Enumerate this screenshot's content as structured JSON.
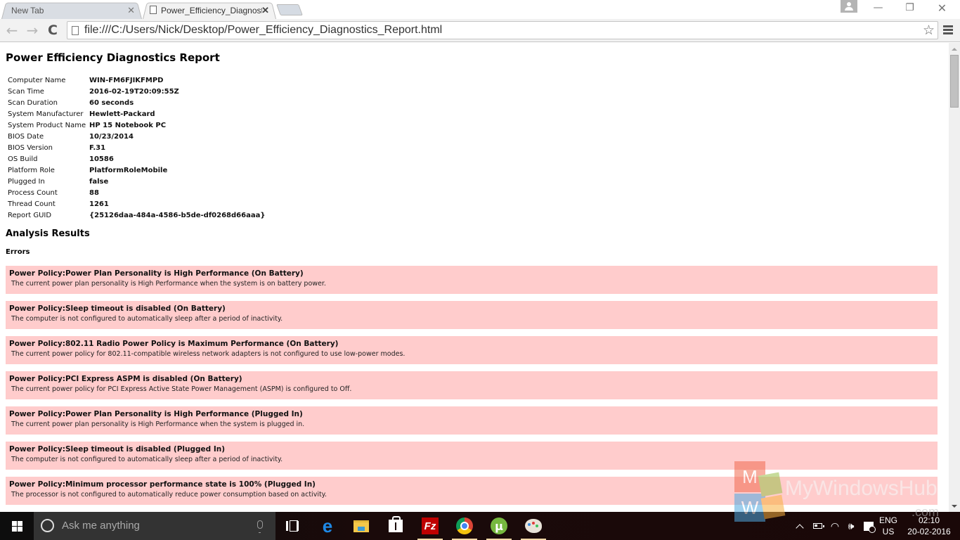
{
  "browser": {
    "tabs": [
      {
        "label": "New Tab",
        "active": false
      },
      {
        "label": "Power_Efficiency_Diagnost",
        "active": true
      }
    ],
    "url": "file:///C:/Users/Nick/Desktop/Power_Efficiency_Diagnostics_Report.html",
    "icons": {
      "back": "←",
      "forward": "→",
      "reload": "C",
      "star": "☆",
      "tab_close": "✕",
      "minimize": "—",
      "restore": "❐",
      "close": "✕"
    }
  },
  "report": {
    "title": "Power Efficiency Diagnostics Report",
    "info": [
      {
        "key": "Computer Name",
        "value": "WIN-FM6FJIKFMPD"
      },
      {
        "key": "Scan Time",
        "value": "2016-02-19T20:09:55Z"
      },
      {
        "key": "Scan Duration",
        "value": "60 seconds"
      },
      {
        "key": "System Manufacturer",
        "value": "Hewlett-Packard"
      },
      {
        "key": "System Product Name",
        "value": "HP 15 Notebook PC"
      },
      {
        "key": "BIOS Date",
        "value": "10/23/2014"
      },
      {
        "key": "BIOS Version",
        "value": "F.31"
      },
      {
        "key": "OS Build",
        "value": "10586"
      },
      {
        "key": "Platform Role",
        "value": "PlatformRoleMobile"
      },
      {
        "key": "Plugged In",
        "value": "false"
      },
      {
        "key": "Process Count",
        "value": "88"
      },
      {
        "key": "Thread Count",
        "value": "1261"
      },
      {
        "key": "Report GUID",
        "value": "{25126daa-484a-4586-b5de-df0268d66aaa}"
      }
    ],
    "analysis_title": "Analysis Results",
    "errors_title": "Errors",
    "error_color": "#ffcccc",
    "errors": [
      {
        "title": "Power Policy:Power Plan Personality is High Performance (On Battery)",
        "desc": "The current power plan personality is High Performance when the system is on battery power."
      },
      {
        "title": "Power Policy:Sleep timeout is disabled (On Battery)",
        "desc": "The computer is not configured to automatically sleep after a period of inactivity."
      },
      {
        "title": "Power Policy:802.11 Radio Power Policy is Maximum Performance (On Battery)",
        "desc": "The current power policy for 802.11-compatible wireless network adapters is not configured to use low-power modes."
      },
      {
        "title": "Power Policy:PCI Express ASPM is disabled (On Battery)",
        "desc": "The current power policy for PCI Express Active State Power Management (ASPM) is configured to Off."
      },
      {
        "title": "Power Policy:Power Plan Personality is High Performance (Plugged In)",
        "desc": "The current power plan personality is High Performance when the system is plugged in."
      },
      {
        "title": "Power Policy:Sleep timeout is disabled (Plugged In)",
        "desc": "The computer is not configured to automatically sleep after a period of inactivity."
      },
      {
        "title": "Power Policy:Minimum processor performance state is 100% (Plugged In)",
        "desc": "The processor is not configured to automatically reduce power consumption based on activity."
      }
    ]
  },
  "watermark": {
    "m": "M",
    "w": "W",
    "text": "MyWindowsHub",
    "suffix": ".com"
  },
  "taskbar": {
    "search_placeholder": "Ask me anything",
    "apps": [
      "task-view",
      "edge",
      "file-explorer",
      "store",
      "filezilla",
      "chrome",
      "utorrent",
      "paint"
    ],
    "edge_glyph": "e",
    "filezilla_glyph": "Fz",
    "utorrent_glyph": "µ",
    "tray": {
      "wifi_glyph": "◠",
      "volume_glyph": "🕪",
      "lang_line1": "ENG",
      "lang_line2": "US",
      "time": "02:10",
      "date": "20-02-2016"
    }
  }
}
